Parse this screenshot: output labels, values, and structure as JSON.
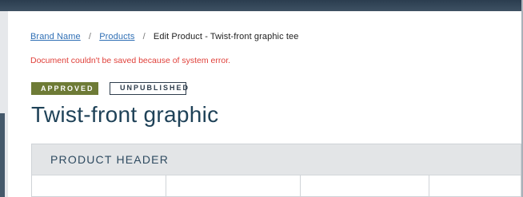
{
  "breadcrumb": {
    "items": [
      {
        "label": "Brand Name",
        "link": true
      },
      {
        "label": "Products",
        "link": true
      },
      {
        "label": "Edit Product - Twist-front graphic tee",
        "link": false
      }
    ],
    "separator": "/"
  },
  "error_message": "Document couldn't be saved because of system error.",
  "badges": {
    "approved": "APPROVED",
    "unpublished": "UNPUBLISHED"
  },
  "page_title": "Twist-front graphic",
  "section": {
    "title": "PRODUCT HEADER"
  },
  "colors": {
    "approved_badge": "#6e7b36",
    "error_text": "#e0403a",
    "link": "#2f6fb5",
    "title": "#1f4258"
  }
}
